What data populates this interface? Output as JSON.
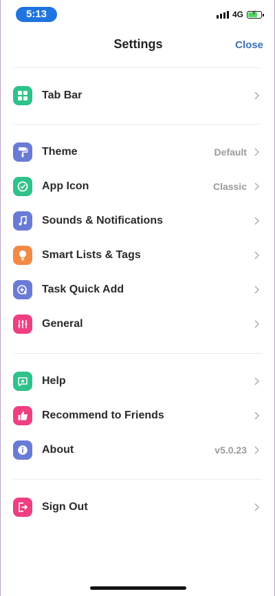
{
  "status_bar": {
    "time": "5:13",
    "network": "4G"
  },
  "nav": {
    "title": "Settings",
    "close_label": "Close"
  },
  "colors": {
    "accent": "#3a6fb8",
    "green": "#2fc28a",
    "purple": "#6a7bd6",
    "orange": "#f28a45",
    "pink": "#ee3f83"
  },
  "sections": [
    {
      "items": [
        {
          "label": "Tab Bar",
          "value": "",
          "icon": "grid-icon"
        }
      ]
    },
    {
      "items": [
        {
          "label": "Theme",
          "value": "Default",
          "icon": "paint-roller-icon"
        },
        {
          "label": "App Icon",
          "value": "Classic",
          "icon": "check-circle-icon"
        },
        {
          "label": "Sounds & Notifications",
          "value": "",
          "icon": "music-note-icon"
        },
        {
          "label": "Smart Lists & Tags",
          "value": "",
          "icon": "light-bulb-icon"
        },
        {
          "label": "Task Quick Add",
          "value": "",
          "icon": "quick-add-icon"
        },
        {
          "label": "General",
          "value": "",
          "icon": "sliders-icon"
        }
      ]
    },
    {
      "items": [
        {
          "label": "Help",
          "value": "",
          "icon": "help-chat-icon"
        },
        {
          "label": "Recommend to Friends",
          "value": "",
          "icon": "thumbs-up-icon"
        },
        {
          "label": "About",
          "value": "v5.0.23",
          "icon": "info-icon"
        }
      ]
    },
    {
      "items": [
        {
          "label": "Sign Out",
          "value": "",
          "icon": "sign-out-icon"
        }
      ]
    }
  ]
}
